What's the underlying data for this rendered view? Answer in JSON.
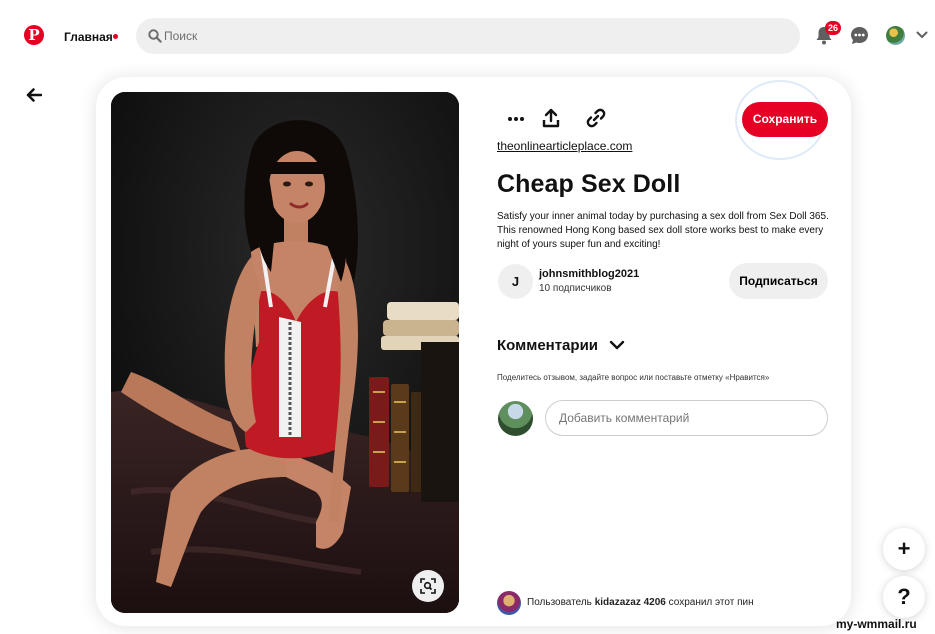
{
  "header": {
    "nav_home": "Главная",
    "search_placeholder": "Поиск",
    "notifications_count": "26",
    "brand_color": "#e60023"
  },
  "pin": {
    "source_link": "theonlinearticleplace.com",
    "title": "Cheap Sex Doll",
    "description": "Satisfy your inner animal today by purchasing a sex doll from Sex Doll 365. This renowned Hong Kong based sex doll store works best to make every night of yours super fun and exciting!",
    "save_label": "Сохранить",
    "actions": [
      "more-icon",
      "share-icon",
      "link-icon"
    ]
  },
  "author": {
    "initial": "J",
    "name": "johnsmithblog2021",
    "subscribers": "10 подписчиков",
    "follow_label": "Подписаться"
  },
  "comments": {
    "heading": "Комментарии",
    "hint": "Поделитесь отзывом, задайте вопрос или поставьте отметку «Нравится»",
    "input_placeholder": "Добавить комментарий"
  },
  "saved_by": {
    "prefix": "Пользователь",
    "user": "kidazazaz 4206",
    "suffix": "сохранил этот пин"
  },
  "fab": {
    "add": "+",
    "help": "?"
  },
  "watermark": "my-wmmail.ru"
}
